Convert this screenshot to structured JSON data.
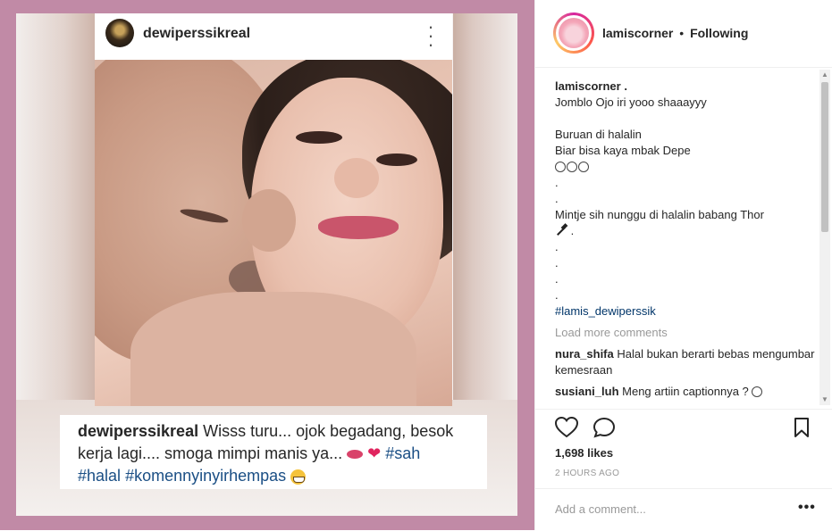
{
  "embedded_post": {
    "username": "dewiperssikreal",
    "caption_user": "dewiperssikreal",
    "caption_line1": " Wisss turu... ojok begadang, besok",
    "caption_line2": "kerja lagi.... smoga mimpi manis ya... ",
    "caption_tag1": "#sah",
    "caption_tag2": "#halal",
    "caption_tag3": "#komennyinyirhempas",
    "emoji_icons": [
      "lips-icon",
      "heart-icon",
      "grin-icon"
    ]
  },
  "panel": {
    "username": "lamiscorner",
    "separator": "•",
    "follow_status": "Following",
    "post_author": "lamiscorner .",
    "caption_lines": [
      "Jomblo Ojo iri yooo shaaayyy",
      "",
      "Buruan di halalin",
      "Biar bisa kaya mbak Depe"
    ],
    "dot": ".",
    "mintje_line": "Mintje sih nunggu di halalin babang Thor",
    "hammer_suffix": " .",
    "hashtag": "#lamis_dewiperssik",
    "load_more": "Load more comments",
    "comments": [
      {
        "user": "nura_shifa",
        "text": " Halal bukan berarti bebas mengumbar kemesraan"
      },
      {
        "user": "susiani_luh",
        "text": " Meng artiin captionnya ? "
      }
    ],
    "likes": "1,698 likes",
    "time": "2 HOURS AGO",
    "add_comment_placeholder": "Add a comment...",
    "more_label": "•••",
    "scroll_up": "▲",
    "scroll_down": "▼"
  },
  "colors": {
    "background_pink": "#c18aa6",
    "hashtag_blue": "#003569",
    "muted_gray": "#999999"
  }
}
